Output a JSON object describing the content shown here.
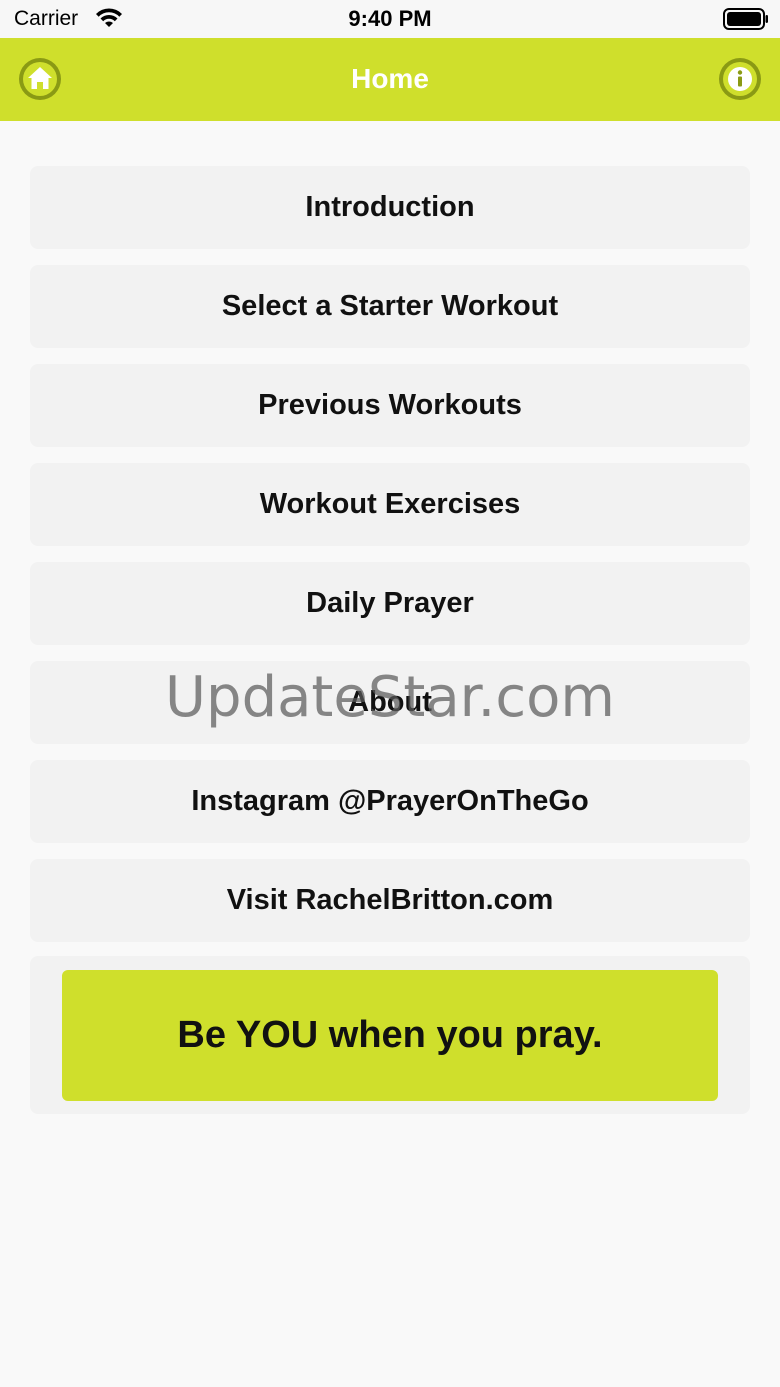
{
  "status_bar": {
    "carrier": "Carrier",
    "time": "9:40 PM"
  },
  "nav": {
    "title": "Home",
    "left_icon": "home-icon",
    "right_icon": "info-icon"
  },
  "menu": {
    "items": [
      {
        "label": "Introduction"
      },
      {
        "label": "Select a Starter Workout"
      },
      {
        "label": "Previous Workouts"
      },
      {
        "label": "Workout Exercises"
      },
      {
        "label": "Daily Prayer"
      },
      {
        "label": "About"
      },
      {
        "label": "Instagram @PrayerOnTheGo"
      },
      {
        "label": "Visit RachelBritton.com"
      }
    ]
  },
  "tagline": "Be YOU when you pray.",
  "watermark": "UpdateStar.com",
  "colors": {
    "accent": "#cfdf2c",
    "accent_dark": "#8a9a14",
    "card": "#f2f2f2",
    "background": "#f9f9f9"
  }
}
